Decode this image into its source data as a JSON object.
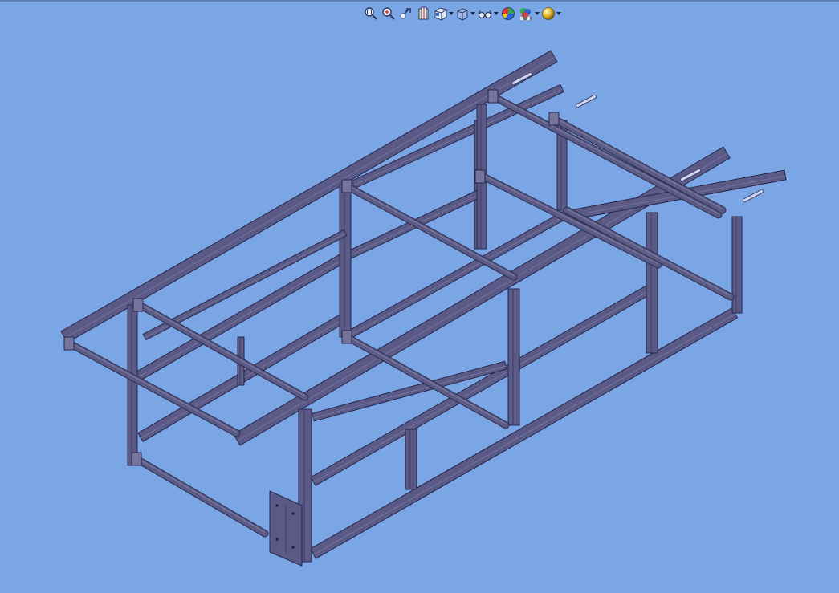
{
  "viewport": {
    "background": "#7aa6e6",
    "model_name": "steel-frame-assembly",
    "steel_color": "#5b5a86",
    "steel_dark": "#3e3d66",
    "steel_light": "#75749d"
  },
  "toolbar": {
    "buttons": [
      {
        "name": "zoom-to-fit-icon",
        "dropdown": false
      },
      {
        "name": "zoom-to-area-icon",
        "dropdown": false
      },
      {
        "name": "previous-view-icon",
        "dropdown": false
      },
      {
        "name": "section-view-icon",
        "dropdown": false
      },
      {
        "name": "view-orientation-icon",
        "dropdown": true
      },
      {
        "name": "display-style-icon",
        "dropdown": true
      },
      {
        "name": "hide-show-items-icon",
        "dropdown": true
      },
      {
        "name": "edit-appearance-icon",
        "dropdown": false
      },
      {
        "name": "apply-scene-icon",
        "dropdown": true
      },
      {
        "name": "view-settings-icon",
        "dropdown": true
      }
    ]
  }
}
